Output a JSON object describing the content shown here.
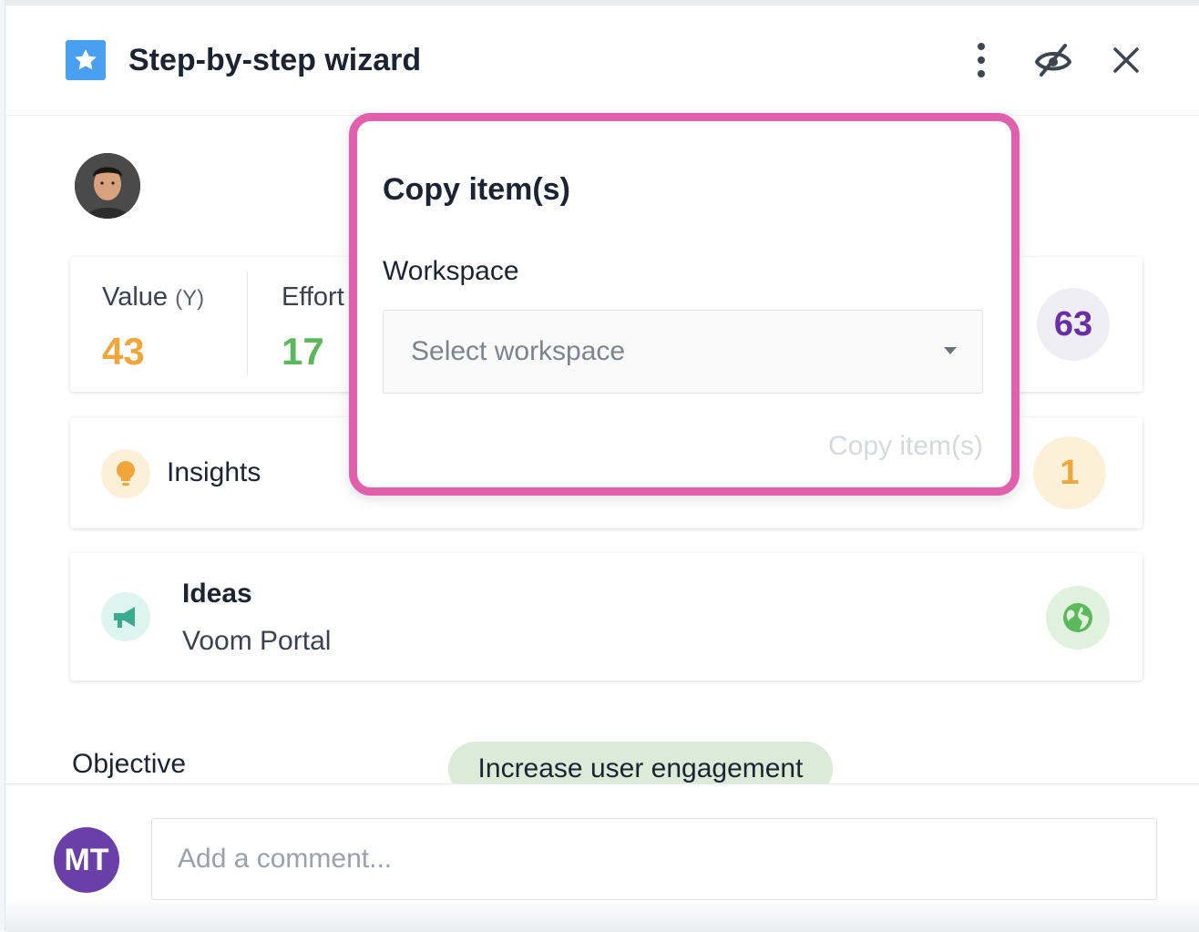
{
  "header": {
    "title": "Step-by-step wizard",
    "icons": [
      "star-icon",
      "more-vertical-icon",
      "hide-eye-icon",
      "close-icon"
    ]
  },
  "metrics": {
    "value_label": "Value",
    "value_axis": "(Y)",
    "value": "43",
    "effort_label": "Effort",
    "effort": "17",
    "score": "63"
  },
  "insights": {
    "label": "Insights",
    "count": "1"
  },
  "ideas": {
    "title": "Ideas",
    "portal": "Voom Portal"
  },
  "objective": {
    "label": "Objective",
    "value": "Increase user engagement"
  },
  "comment": {
    "avatar_initials": "MT",
    "placeholder": "Add a comment..."
  },
  "modal": {
    "title": "Copy item(s)",
    "field_label": "Workspace",
    "select_placeholder": "Select workspace",
    "action_label": "Copy item(s)"
  },
  "colors": {
    "value": "#f0a63a",
    "effort": "#5bb85b",
    "score": "#6b2fa5",
    "insight_count": "#f0a63a",
    "modal_border": "#e060ae",
    "objective_pill": "#dcebd8",
    "avatar": "#6b3fa8"
  }
}
